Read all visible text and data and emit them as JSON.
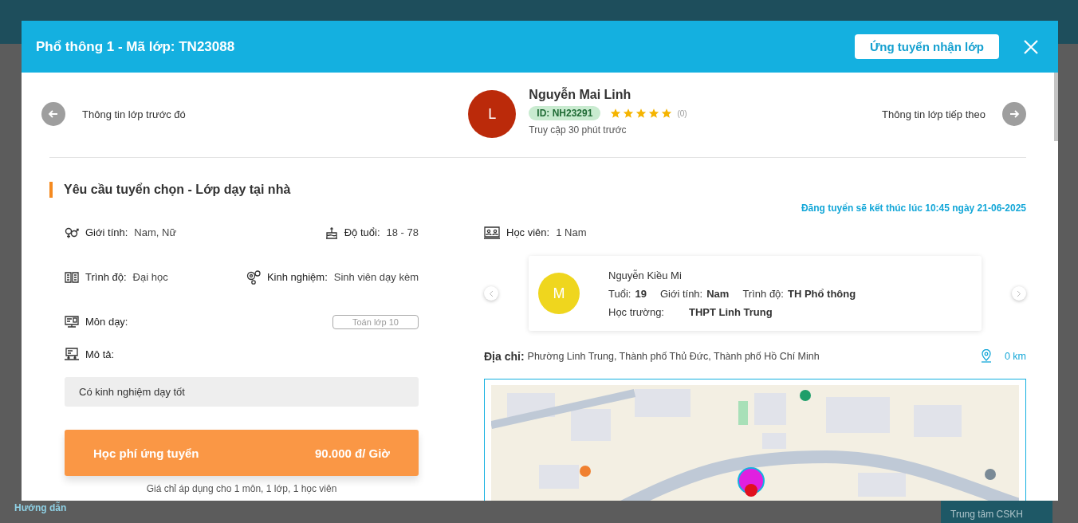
{
  "background": {
    "guide_link": "Hướng dẫn",
    "support": "Trung tâm CSKH"
  },
  "modal": {
    "title": "Phổ thông 1 - Mã lớp: TN23088",
    "apply_button": "Ứng tuyển nhận lớp",
    "prev": "Thông tin lớp trước đó",
    "next": "Thông tin lớp tiếp theo"
  },
  "tutor": {
    "initial": "L",
    "name": "Nguyễn Mai Linh",
    "id": "ID: NH23291",
    "stars": 5,
    "review_count": "(0)",
    "last_seen": "Truy cập 30 phút trước"
  },
  "requirements": {
    "heading": "Yêu cầu tuyển chọn - Lớp dạy tại nhà",
    "deadline": "Đăng tuyển sẽ kết thúc lúc 10:45 ngày 21-06-2025",
    "fields": [
      {
        "kind": "gender",
        "label": "Giới tính:",
        "value": "Nam, Nữ"
      },
      {
        "kind": "age",
        "label": "Độ tuổi:",
        "value": "18 - 78"
      },
      {
        "kind": "level",
        "label": "Trình độ:",
        "value": "Đại học"
      },
      {
        "kind": "experience",
        "label": "Kinh nghiệm:",
        "value": "Sinh viên dạy kèm"
      }
    ],
    "subject": {
      "label": "Môn dạy:",
      "tag": "Toán lớp 10"
    },
    "description": {
      "label": "Mô tả:",
      "text": "Có kinh nghiệm dạy tốt"
    },
    "fee": {
      "label": "Học phí ứng tuyển",
      "value": "90.000 đ/ Giờ",
      "note": "Giá chỉ áp dụng cho 1 môn, 1 lớp, 1 học viên"
    }
  },
  "students": {
    "label": "Học viên:",
    "value": "1 Nam",
    "items": [
      {
        "initial": "M",
        "name": "Nguyễn Kiều Mi",
        "age_label": "Tuổi:",
        "age": "19",
        "gender_label": "Giới tính:",
        "gender": "Nam",
        "level_label": "Trình độ:",
        "level": "TH Phổ thông",
        "school_label": "Học trường:",
        "school": "THPT Linh Trung"
      }
    ]
  },
  "address": {
    "label": "Địa chỉ:",
    "value": "Phường Linh Trung, Thành phố Thủ Đức, Thành phố Hồ Chí Minh",
    "distance": "0 km"
  }
}
